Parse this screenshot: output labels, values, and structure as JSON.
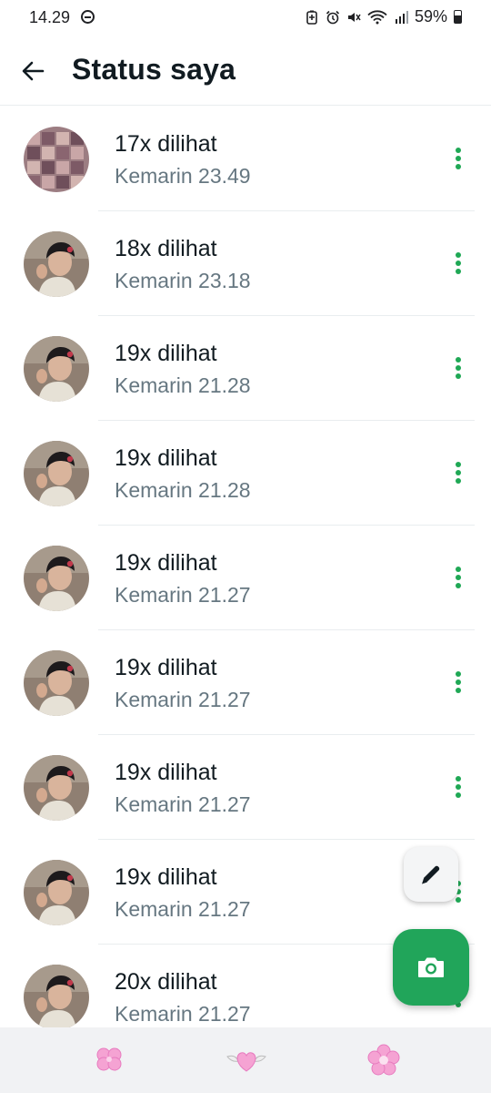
{
  "status_bar": {
    "time": "14.29",
    "battery": "59%",
    "battery_level": 0.59,
    "icons": [
      "do-not-disturb-icon",
      "battery-saver-icon",
      "alarm-icon",
      "mute-icon",
      "wifi-icon",
      "signal-icon",
      "battery-icon"
    ]
  },
  "header": {
    "back_icon": "arrow-left-icon",
    "title": "Status saya"
  },
  "statuses": [
    {
      "views": "17x dilihat",
      "time": "Kemarin 23.49",
      "thumb": "collage"
    },
    {
      "views": "18x dilihat",
      "time": "Kemarin 23.18",
      "thumb": "selfie"
    },
    {
      "views": "19x dilihat",
      "time": "Kemarin 21.28",
      "thumb": "selfie"
    },
    {
      "views": "19x dilihat",
      "time": "Kemarin 21.28",
      "thumb": "selfie"
    },
    {
      "views": "19x dilihat",
      "time": "Kemarin 21.27",
      "thumb": "selfie"
    },
    {
      "views": "19x dilihat",
      "time": "Kemarin 21.27",
      "thumb": "selfie"
    },
    {
      "views": "19x dilihat",
      "time": "Kemarin 21.27",
      "thumb": "selfie"
    },
    {
      "views": "19x dilihat",
      "time": "Kemarin 21.27",
      "thumb": "selfie"
    },
    {
      "views": "20x dilihat",
      "time": "Kemarin 21.27",
      "thumb": "selfie"
    }
  ],
  "fabs": {
    "edit_icon": "pencil-icon",
    "camera_icon": "camera-icon"
  },
  "bottom_decor": [
    "clover-icon",
    "winged-heart-icon",
    "flower-icon"
  ],
  "colors": {
    "accent": "#21a55a",
    "more_dots": "#1fa855",
    "title": "#111b21",
    "subtitle": "#667781",
    "bottom_bar": "#f1f2f4",
    "decor_pink": "#f5a3d3"
  }
}
